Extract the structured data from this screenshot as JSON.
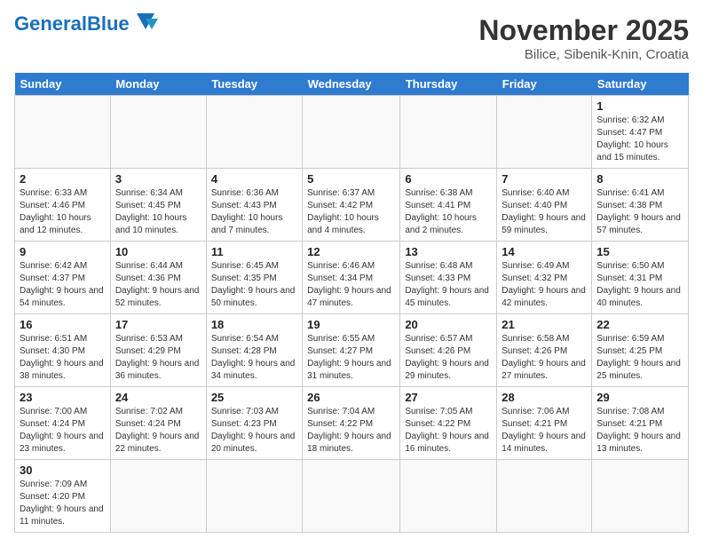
{
  "header": {
    "logo_text1": "General",
    "logo_text2": "Blue",
    "month_year": "November 2025",
    "location": "Bilice, Sibenik-Knin, Croatia"
  },
  "days_of_week": [
    "Sunday",
    "Monday",
    "Tuesday",
    "Wednesday",
    "Thursday",
    "Friday",
    "Saturday"
  ],
  "weeks": [
    [
      {
        "day": "",
        "info": ""
      },
      {
        "day": "",
        "info": ""
      },
      {
        "day": "",
        "info": ""
      },
      {
        "day": "",
        "info": ""
      },
      {
        "day": "",
        "info": ""
      },
      {
        "day": "",
        "info": ""
      },
      {
        "day": "1",
        "info": "Sunrise: 6:32 AM\nSunset: 4:47 PM\nDaylight: 10 hours and 15 minutes."
      }
    ],
    [
      {
        "day": "2",
        "info": "Sunrise: 6:33 AM\nSunset: 4:46 PM\nDaylight: 10 hours and 12 minutes."
      },
      {
        "day": "3",
        "info": "Sunrise: 6:34 AM\nSunset: 4:45 PM\nDaylight: 10 hours and 10 minutes."
      },
      {
        "day": "4",
        "info": "Sunrise: 6:36 AM\nSunset: 4:43 PM\nDaylight: 10 hours and 7 minutes."
      },
      {
        "day": "5",
        "info": "Sunrise: 6:37 AM\nSunset: 4:42 PM\nDaylight: 10 hours and 4 minutes."
      },
      {
        "day": "6",
        "info": "Sunrise: 6:38 AM\nSunset: 4:41 PM\nDaylight: 10 hours and 2 minutes."
      },
      {
        "day": "7",
        "info": "Sunrise: 6:40 AM\nSunset: 4:40 PM\nDaylight: 9 hours and 59 minutes."
      },
      {
        "day": "8",
        "info": "Sunrise: 6:41 AM\nSunset: 4:38 PM\nDaylight: 9 hours and 57 minutes."
      }
    ],
    [
      {
        "day": "9",
        "info": "Sunrise: 6:42 AM\nSunset: 4:37 PM\nDaylight: 9 hours and 54 minutes."
      },
      {
        "day": "10",
        "info": "Sunrise: 6:44 AM\nSunset: 4:36 PM\nDaylight: 9 hours and 52 minutes."
      },
      {
        "day": "11",
        "info": "Sunrise: 6:45 AM\nSunset: 4:35 PM\nDaylight: 9 hours and 50 minutes."
      },
      {
        "day": "12",
        "info": "Sunrise: 6:46 AM\nSunset: 4:34 PM\nDaylight: 9 hours and 47 minutes."
      },
      {
        "day": "13",
        "info": "Sunrise: 6:48 AM\nSunset: 4:33 PM\nDaylight: 9 hours and 45 minutes."
      },
      {
        "day": "14",
        "info": "Sunrise: 6:49 AM\nSunset: 4:32 PM\nDaylight: 9 hours and 42 minutes."
      },
      {
        "day": "15",
        "info": "Sunrise: 6:50 AM\nSunset: 4:31 PM\nDaylight: 9 hours and 40 minutes."
      }
    ],
    [
      {
        "day": "16",
        "info": "Sunrise: 6:51 AM\nSunset: 4:30 PM\nDaylight: 9 hours and 38 minutes."
      },
      {
        "day": "17",
        "info": "Sunrise: 6:53 AM\nSunset: 4:29 PM\nDaylight: 9 hours and 36 minutes."
      },
      {
        "day": "18",
        "info": "Sunrise: 6:54 AM\nSunset: 4:28 PM\nDaylight: 9 hours and 34 minutes."
      },
      {
        "day": "19",
        "info": "Sunrise: 6:55 AM\nSunset: 4:27 PM\nDaylight: 9 hours and 31 minutes."
      },
      {
        "day": "20",
        "info": "Sunrise: 6:57 AM\nSunset: 4:26 PM\nDaylight: 9 hours and 29 minutes."
      },
      {
        "day": "21",
        "info": "Sunrise: 6:58 AM\nSunset: 4:26 PM\nDaylight: 9 hours and 27 minutes."
      },
      {
        "day": "22",
        "info": "Sunrise: 6:59 AM\nSunset: 4:25 PM\nDaylight: 9 hours and 25 minutes."
      }
    ],
    [
      {
        "day": "23",
        "info": "Sunrise: 7:00 AM\nSunset: 4:24 PM\nDaylight: 9 hours and 23 minutes."
      },
      {
        "day": "24",
        "info": "Sunrise: 7:02 AM\nSunset: 4:24 PM\nDaylight: 9 hours and 22 minutes."
      },
      {
        "day": "25",
        "info": "Sunrise: 7:03 AM\nSunset: 4:23 PM\nDaylight: 9 hours and 20 minutes."
      },
      {
        "day": "26",
        "info": "Sunrise: 7:04 AM\nSunset: 4:22 PM\nDaylight: 9 hours and 18 minutes."
      },
      {
        "day": "27",
        "info": "Sunrise: 7:05 AM\nSunset: 4:22 PM\nDaylight: 9 hours and 16 minutes."
      },
      {
        "day": "28",
        "info": "Sunrise: 7:06 AM\nSunset: 4:21 PM\nDaylight: 9 hours and 14 minutes."
      },
      {
        "day": "29",
        "info": "Sunrise: 7:08 AM\nSunset: 4:21 PM\nDaylight: 9 hours and 13 minutes."
      }
    ],
    [
      {
        "day": "30",
        "info": "Sunrise: 7:09 AM\nSunset: 4:20 PM\nDaylight: 9 hours and 11 minutes."
      },
      {
        "day": "",
        "info": ""
      },
      {
        "day": "",
        "info": ""
      },
      {
        "day": "",
        "info": ""
      },
      {
        "day": "",
        "info": ""
      },
      {
        "day": "",
        "info": ""
      },
      {
        "day": "",
        "info": ""
      }
    ]
  ]
}
